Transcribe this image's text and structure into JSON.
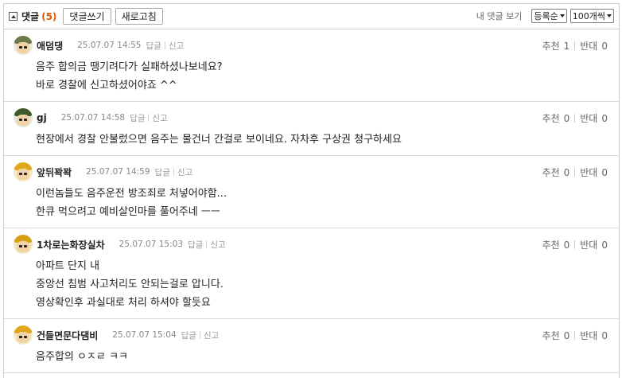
{
  "header": {
    "title": "댓글",
    "count": "(5)",
    "write_button": "댓글쓰기",
    "refresh_button": "새로고침",
    "my_comments": "내 댓글 보기",
    "sort_select": "등록순",
    "per_page_select": "100개씩"
  },
  "labels": {
    "reply": "답글",
    "report": "신고",
    "upvote": "추천",
    "downvote": "반대"
  },
  "comments": [
    {
      "name": "애덤댕",
      "date": "25.07.07 14:55",
      "up": "1",
      "down": "0",
      "lines": [
        "음주 합의금 땡기려다가 실패하셨나보네요?",
        "바로 경찰에 신고하셨어야죠 ^^"
      ]
    },
    {
      "name": "gj",
      "date": "25.07.07 14:58",
      "up": "0",
      "down": "0",
      "lines": [
        "현장에서 경찰 안불렀으면 음주는 물건너 간걸로 보이네요. 자차후 구상권 청구하세요"
      ]
    },
    {
      "name": "앞뒤꽉꽉",
      "date": "25.07.07 14:59",
      "up": "0",
      "down": "0",
      "lines": [
        "이런놈들도 음주운전 방조죄로 처넣어야함...",
        "한큐 먹으려고 예비살인마를 풀어주네 ㅡㅡ"
      ]
    },
    {
      "name": "1차로는화장실차",
      "date": "25.07.07 15:03",
      "up": "0",
      "down": "0",
      "lines": [
        "아파트 단지 내",
        "중앙선 침범 사고처리도 안되는걸로 압니다.",
        "영상확인후 과실대로 처리 하셔야 할듯요"
      ]
    },
    {
      "name": "건들면문다댐비",
      "date": "25.07.07 15:04",
      "up": "0",
      "down": "0",
      "lines": [
        "음주합의 ㅇㅈㄹ ㅋㅋ"
      ]
    }
  ],
  "avatars": [
    {
      "hat": "#6b7b4a",
      "bg": "#e8e8d8"
    },
    {
      "hat": "#3f5a2a",
      "bg": "#e4e8d8"
    },
    {
      "hat": "#e0a71a",
      "bg": "#f6e9c4"
    },
    {
      "hat": "#d8a015",
      "bg": "#f3e6c0"
    },
    {
      "hat": "#e0a71a",
      "bg": "#f6e9c4"
    }
  ]
}
